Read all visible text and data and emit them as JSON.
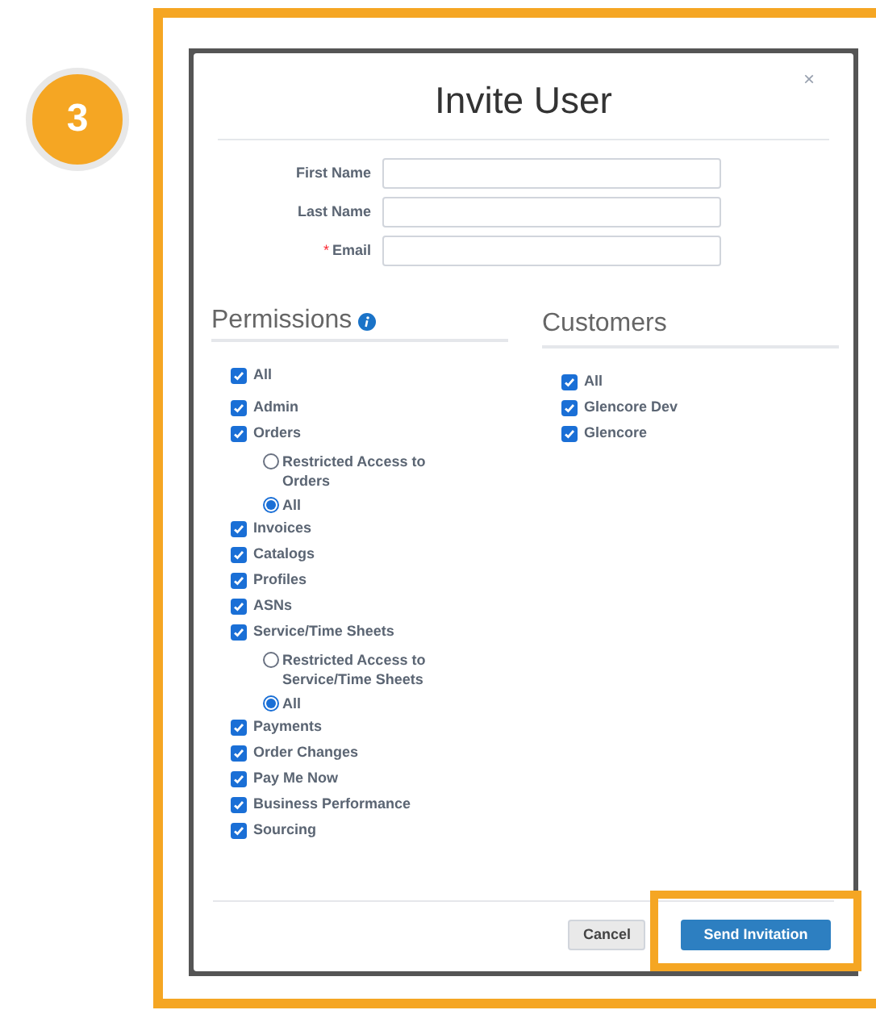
{
  "step_badge": "3",
  "dialog": {
    "title": "Invite User",
    "close": "×",
    "fields": [
      {
        "label": "First Name"
      },
      {
        "label": "Last Name"
      },
      {
        "label": "Email",
        "required_mark": "*"
      }
    ],
    "permissions": {
      "heading": "Permissions",
      "items": [
        {
          "label": "All",
          "checked": true
        },
        {
          "label": "Admin",
          "checked": true
        },
        {
          "label": "Orders",
          "checked": true,
          "options": [
            {
              "label": "Restricted Access to Orders",
              "selected": false
            },
            {
              "label": "All",
              "selected": true
            }
          ]
        },
        {
          "label": "Invoices",
          "checked": true
        },
        {
          "label": "Catalogs",
          "checked": true
        },
        {
          "label": "Profiles",
          "checked": true
        },
        {
          "label": "ASNs",
          "checked": true
        },
        {
          "label": "Service/Time Sheets",
          "checked": true,
          "options": [
            {
              "label": "Restricted Access to Service/Time Sheets",
              "selected": false
            },
            {
              "label": "All",
              "selected": true
            }
          ]
        },
        {
          "label": "Payments",
          "checked": true
        },
        {
          "label": "Order Changes",
          "checked": true
        },
        {
          "label": "Pay Me Now",
          "checked": true
        },
        {
          "label": "Business Performance",
          "checked": true
        },
        {
          "label": "Sourcing",
          "checked": true
        }
      ]
    },
    "customers": {
      "heading": "Customers",
      "items": [
        {
          "label": "All",
          "checked": true
        },
        {
          "label": "Glencore Dev",
          "checked": true
        },
        {
          "label": "Glencore",
          "checked": true
        }
      ]
    },
    "buttons": {
      "cancel": "Cancel",
      "send": "Send Invitation"
    }
  }
}
